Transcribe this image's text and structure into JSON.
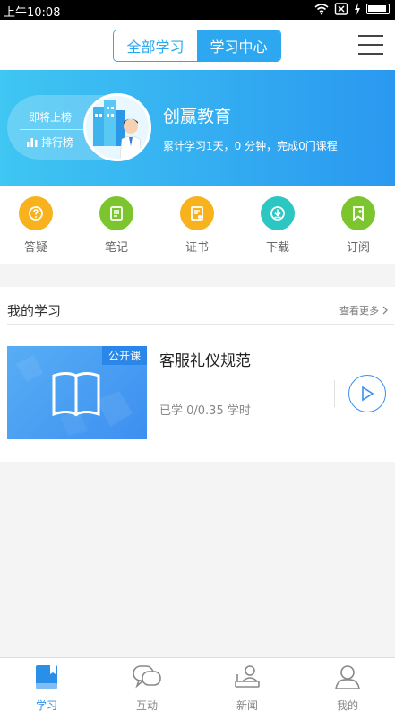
{
  "status": {
    "time": "上午10:08"
  },
  "header": {
    "tabs": [
      {
        "label": "全部学习",
        "active": false
      },
      {
        "label": "学习中心",
        "active": true
      }
    ]
  },
  "banner": {
    "rank_hint": "即将上榜",
    "rank_label": "排行榜",
    "org_name": "创赢教育",
    "stats": "累计学习1天，0 分钟，完成0门课程"
  },
  "quick": [
    {
      "label": "答疑",
      "icon": "question-icon",
      "color": "#f7b21e"
    },
    {
      "label": "笔记",
      "icon": "notebook-icon",
      "color": "#7cc52f"
    },
    {
      "label": "证书",
      "icon": "certificate-icon",
      "color": "#f7b21e"
    },
    {
      "label": "下载",
      "icon": "download-icon",
      "color": "#2cc7c2"
    },
    {
      "label": "订阅",
      "icon": "subscribe-icon",
      "color": "#7cc52f"
    }
  ],
  "my_learning": {
    "title": "我的学习",
    "more": "查看更多",
    "course": {
      "tag": "公开课",
      "title": "客服礼仪规范",
      "progress": "已学 0/0.35 学时"
    }
  },
  "tabbar": [
    {
      "label": "学习",
      "icon": "book-icon",
      "active": true
    },
    {
      "label": "互动",
      "icon": "chat-icon",
      "active": false
    },
    {
      "label": "新闻",
      "icon": "news-icon",
      "active": false
    },
    {
      "label": "我的",
      "icon": "user-icon",
      "active": false
    }
  ],
  "colors": {
    "accent": "#2da7ef",
    "tab_active": "#2a8fe8",
    "tab_inactive": "#888888"
  }
}
